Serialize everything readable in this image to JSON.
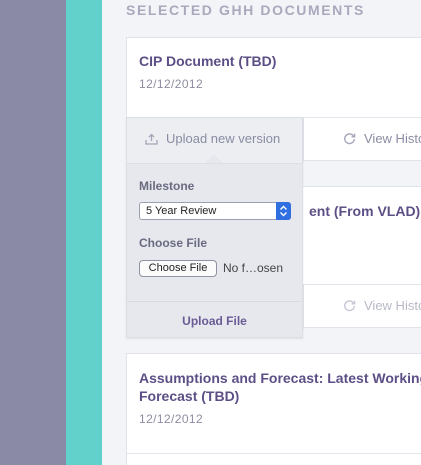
{
  "section_heading": "SELECTED GHH DOCUMENTS",
  "documents": [
    {
      "title": "CIP Document (TBD)",
      "date": "12/12/2012",
      "upload_label": "Upload new version",
      "history_label": "View History"
    },
    {
      "title_visible_fragment": "ent (From VLAD)",
      "history_label": "View History"
    },
    {
      "title_line1": "Assumptions and Forecast: Latest Working",
      "title_line2": "Forecast (TBD)",
      "date": "12/12/2012"
    }
  ],
  "upload_panel": {
    "milestone_label": "Milestone",
    "milestone_selected": "5 Year Review",
    "file_label": "Choose File",
    "file_button": "Choose File",
    "file_status": "No f…osen",
    "submit_label": "Upload File"
  },
  "colors": {
    "left_rail": "#8a8aa6",
    "teal_rail": "#62d0cb",
    "title": "#5d4f86",
    "accent_blue": "#2f6fe0"
  },
  "icons": {
    "upload": "upload-tray-icon",
    "history": "history-refresh-icon",
    "select": "select-updown-icon"
  }
}
